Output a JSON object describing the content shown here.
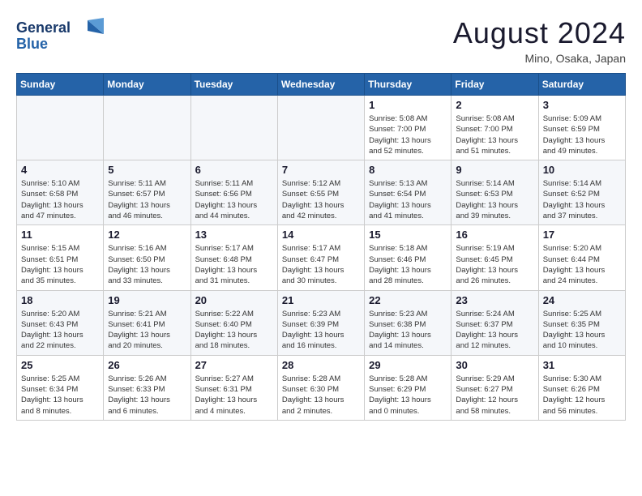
{
  "header": {
    "logo_line1": "General",
    "logo_line2": "Blue",
    "title": "August 2024",
    "subtitle": "Mino, Osaka, Japan"
  },
  "weekdays": [
    "Sunday",
    "Monday",
    "Tuesday",
    "Wednesday",
    "Thursday",
    "Friday",
    "Saturday"
  ],
  "weeks": [
    [
      {
        "day": "",
        "info": ""
      },
      {
        "day": "",
        "info": ""
      },
      {
        "day": "",
        "info": ""
      },
      {
        "day": "",
        "info": ""
      },
      {
        "day": "1",
        "info": "Sunrise: 5:08 AM\nSunset: 7:00 PM\nDaylight: 13 hours\nand 52 minutes."
      },
      {
        "day": "2",
        "info": "Sunrise: 5:08 AM\nSunset: 7:00 PM\nDaylight: 13 hours\nand 51 minutes."
      },
      {
        "day": "3",
        "info": "Sunrise: 5:09 AM\nSunset: 6:59 PM\nDaylight: 13 hours\nand 49 minutes."
      }
    ],
    [
      {
        "day": "4",
        "info": "Sunrise: 5:10 AM\nSunset: 6:58 PM\nDaylight: 13 hours\nand 47 minutes."
      },
      {
        "day": "5",
        "info": "Sunrise: 5:11 AM\nSunset: 6:57 PM\nDaylight: 13 hours\nand 46 minutes."
      },
      {
        "day": "6",
        "info": "Sunrise: 5:11 AM\nSunset: 6:56 PM\nDaylight: 13 hours\nand 44 minutes."
      },
      {
        "day": "7",
        "info": "Sunrise: 5:12 AM\nSunset: 6:55 PM\nDaylight: 13 hours\nand 42 minutes."
      },
      {
        "day": "8",
        "info": "Sunrise: 5:13 AM\nSunset: 6:54 PM\nDaylight: 13 hours\nand 41 minutes."
      },
      {
        "day": "9",
        "info": "Sunrise: 5:14 AM\nSunset: 6:53 PM\nDaylight: 13 hours\nand 39 minutes."
      },
      {
        "day": "10",
        "info": "Sunrise: 5:14 AM\nSunset: 6:52 PM\nDaylight: 13 hours\nand 37 minutes."
      }
    ],
    [
      {
        "day": "11",
        "info": "Sunrise: 5:15 AM\nSunset: 6:51 PM\nDaylight: 13 hours\nand 35 minutes."
      },
      {
        "day": "12",
        "info": "Sunrise: 5:16 AM\nSunset: 6:50 PM\nDaylight: 13 hours\nand 33 minutes."
      },
      {
        "day": "13",
        "info": "Sunrise: 5:17 AM\nSunset: 6:48 PM\nDaylight: 13 hours\nand 31 minutes."
      },
      {
        "day": "14",
        "info": "Sunrise: 5:17 AM\nSunset: 6:47 PM\nDaylight: 13 hours\nand 30 minutes."
      },
      {
        "day": "15",
        "info": "Sunrise: 5:18 AM\nSunset: 6:46 PM\nDaylight: 13 hours\nand 28 minutes."
      },
      {
        "day": "16",
        "info": "Sunrise: 5:19 AM\nSunset: 6:45 PM\nDaylight: 13 hours\nand 26 minutes."
      },
      {
        "day": "17",
        "info": "Sunrise: 5:20 AM\nSunset: 6:44 PM\nDaylight: 13 hours\nand 24 minutes."
      }
    ],
    [
      {
        "day": "18",
        "info": "Sunrise: 5:20 AM\nSunset: 6:43 PM\nDaylight: 13 hours\nand 22 minutes."
      },
      {
        "day": "19",
        "info": "Sunrise: 5:21 AM\nSunset: 6:41 PM\nDaylight: 13 hours\nand 20 minutes."
      },
      {
        "day": "20",
        "info": "Sunrise: 5:22 AM\nSunset: 6:40 PM\nDaylight: 13 hours\nand 18 minutes."
      },
      {
        "day": "21",
        "info": "Sunrise: 5:23 AM\nSunset: 6:39 PM\nDaylight: 13 hours\nand 16 minutes."
      },
      {
        "day": "22",
        "info": "Sunrise: 5:23 AM\nSunset: 6:38 PM\nDaylight: 13 hours\nand 14 minutes."
      },
      {
        "day": "23",
        "info": "Sunrise: 5:24 AM\nSunset: 6:37 PM\nDaylight: 13 hours\nand 12 minutes."
      },
      {
        "day": "24",
        "info": "Sunrise: 5:25 AM\nSunset: 6:35 PM\nDaylight: 13 hours\nand 10 minutes."
      }
    ],
    [
      {
        "day": "25",
        "info": "Sunrise: 5:25 AM\nSunset: 6:34 PM\nDaylight: 13 hours\nand 8 minutes."
      },
      {
        "day": "26",
        "info": "Sunrise: 5:26 AM\nSunset: 6:33 PM\nDaylight: 13 hours\nand 6 minutes."
      },
      {
        "day": "27",
        "info": "Sunrise: 5:27 AM\nSunset: 6:31 PM\nDaylight: 13 hours\nand 4 minutes."
      },
      {
        "day": "28",
        "info": "Sunrise: 5:28 AM\nSunset: 6:30 PM\nDaylight: 13 hours\nand 2 minutes."
      },
      {
        "day": "29",
        "info": "Sunrise: 5:28 AM\nSunset: 6:29 PM\nDaylight: 13 hours\nand 0 minutes."
      },
      {
        "day": "30",
        "info": "Sunrise: 5:29 AM\nSunset: 6:27 PM\nDaylight: 12 hours\nand 58 minutes."
      },
      {
        "day": "31",
        "info": "Sunrise: 5:30 AM\nSunset: 6:26 PM\nDaylight: 12 hours\nand 56 minutes."
      }
    ]
  ]
}
